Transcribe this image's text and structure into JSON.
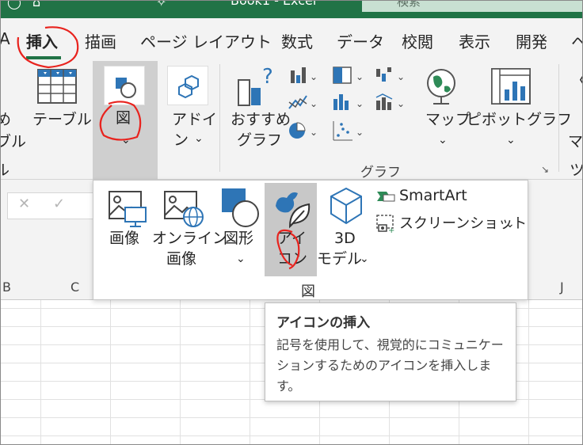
{
  "titlebar": {
    "book": "Book1 - Excel",
    "search": "検索"
  },
  "tabs": [
    {
      "label": "挿入",
      "active": true
    },
    {
      "label": "描画"
    },
    {
      "label": "ページ レイアウト"
    },
    {
      "label": "数式"
    },
    {
      "label": "データ"
    },
    {
      "label": "校閲"
    },
    {
      "label": "表示"
    },
    {
      "label": "開発"
    },
    {
      "label": "ヘ"
    }
  ],
  "ribbon": {
    "partial_left_1": "め",
    "partial_left_2": "ブル",
    "partial_left_3": "ル",
    "table": "テーブル",
    "zu": "図",
    "addin_1": "アドイ",
    "addin_2": "ン",
    "recommended_1": "おすすめ",
    "recommended_2": "グラフ",
    "map": "マップ",
    "pivot_chart": "ピボットグラフ",
    "partial_right_1": "マ",
    "partial_right_2": "ツ",
    "group_label": "グラフ"
  },
  "dropdown": {
    "image": "画像",
    "online_1": "オンライン",
    "online_2": "画像",
    "shapes": "図形",
    "icons_1": "アイ",
    "icons_2": "コン",
    "model_1": "3D",
    "model_2": "モデル",
    "smartart": "SmartArt",
    "screenshot": "スクリーンショット",
    "group_label": "図"
  },
  "columns": [
    "B",
    "C",
    "J"
  ],
  "tooltip": {
    "title": "アイコンの挿入",
    "body": "記号を使用して、視覚的にコミュニケーションするためのアイコンを挿入します。"
  },
  "colors": {
    "excel_green": "#217346",
    "annotation_red": "#e8231e",
    "chart_blue": "#2e75b6"
  }
}
